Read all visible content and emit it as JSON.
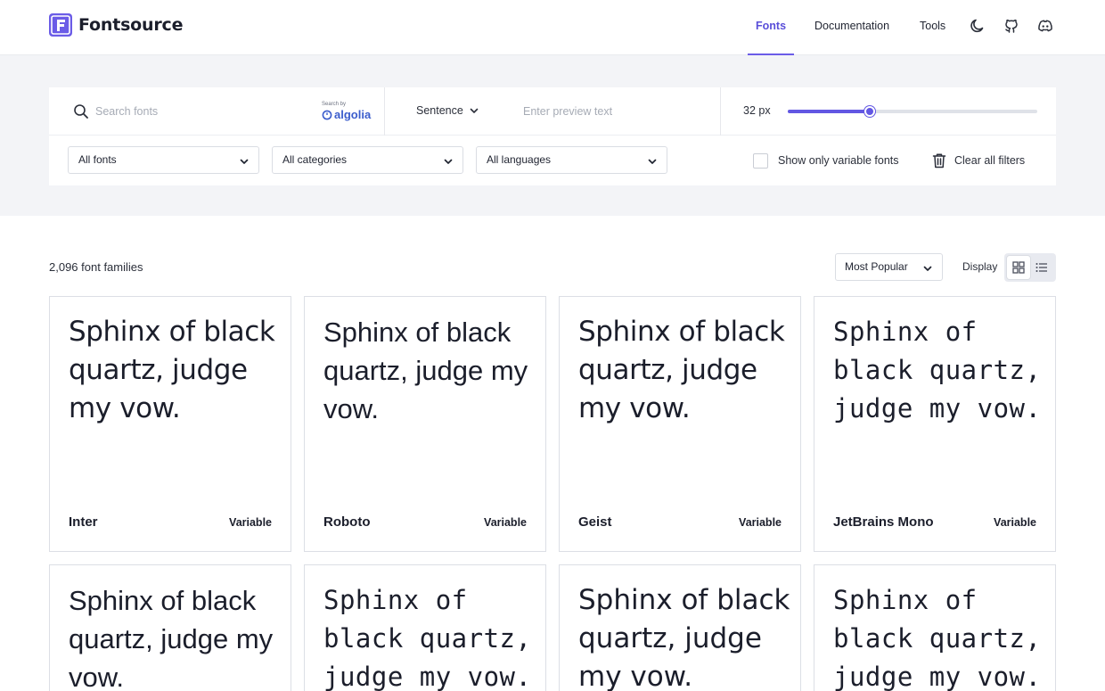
{
  "brand": {
    "name": "Fontsource",
    "accent": "#6b5ce7"
  },
  "nav": {
    "fonts": "Fonts",
    "documentation": "Documentation",
    "tools": "Tools"
  },
  "header_icons": [
    "moon-icon",
    "github-icon",
    "discord-icon"
  ],
  "search": {
    "placeholder": "Search fonts",
    "powered_small": "Search by",
    "powered_brand": "algolia"
  },
  "preview": {
    "mode": "Sentence",
    "placeholder": "Enter preview text"
  },
  "size": {
    "label": "32 px",
    "value": 32,
    "fraction": 0.33
  },
  "filters": {
    "fonts": "All fonts",
    "categories": "All categories",
    "languages": "All languages",
    "variable_only": "Show only variable fonts",
    "clear": "Clear all filters"
  },
  "results": {
    "count": "2,096 font families",
    "sort": "Most Popular",
    "display_label": "Display"
  },
  "cards": [
    {
      "sample": "Sphinx of black quartz, judge my vow.",
      "name": "Inter",
      "tag": "Variable"
    },
    {
      "sample": "Sphinx of black quartz, judge my vow.",
      "name": "Roboto",
      "tag": "Variable"
    },
    {
      "sample": "Sphinx of black quartz, judge my vow.",
      "name": "Geist",
      "tag": "Variable"
    },
    {
      "sample": "Sphinx of black quartz, judge my vow.",
      "name": "JetBrains Mono",
      "tag": "Variable"
    },
    {
      "sample": "Sphinx of black quartz, judge my vow."
    },
    {
      "sample": "Sphinx of black quartz, judge my vow."
    },
    {
      "sample": "Sphinx of black quartz, judge my vow."
    },
    {
      "sample": "Sphinx of black quartz, judge my vow."
    }
  ]
}
